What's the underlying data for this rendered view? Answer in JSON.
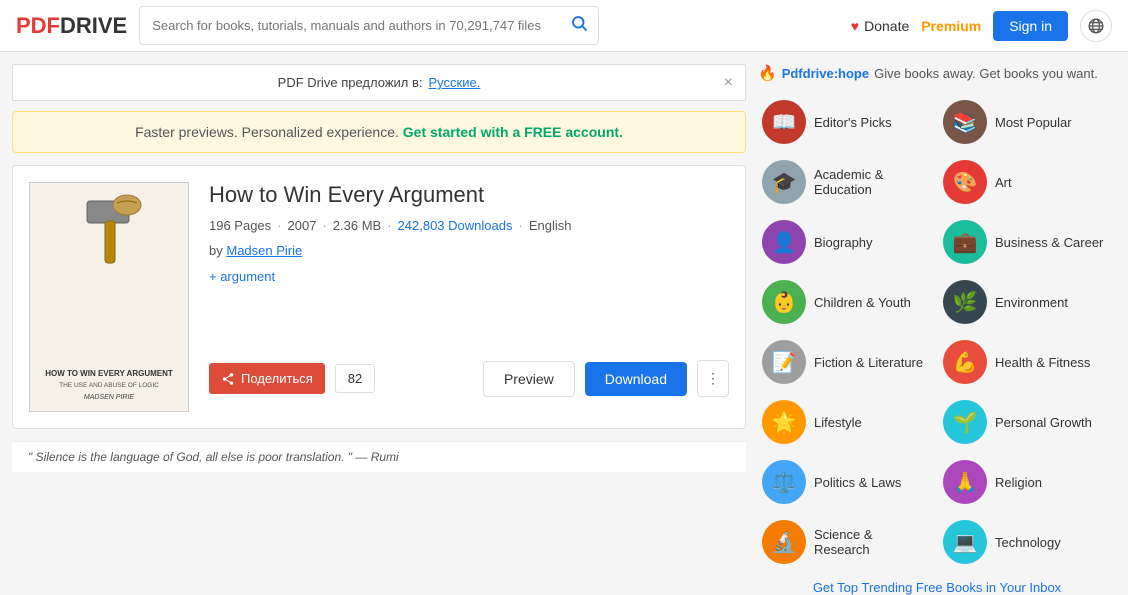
{
  "header": {
    "logo_pdf": "PDF",
    "logo_drive": "DRIVE",
    "search_placeholder": "Search for books, tutorials, manuals and authors in 70,291,747 files",
    "donate_label": "Donate",
    "premium_label": "Premium",
    "signin_label": "Sign in"
  },
  "lang_banner": {
    "text": "PDF Drive предложил в:",
    "link_text": "Русские.",
    "close_symbol": "×"
  },
  "promo_banner": {
    "text": "Faster previews. Personalized experience.",
    "cta": "Get started with a FREE account."
  },
  "book": {
    "title": "How to Win Every Argument",
    "pages": "196 Pages",
    "year": "2007",
    "size": "2.36 MB",
    "downloads": "242,803 Downloads",
    "language": "English",
    "author_prefix": "by",
    "author": "Madsen Pirie",
    "tag": "+ argument",
    "share_label": "Поделиться",
    "share_count": "82",
    "preview_label": "Preview",
    "download_label": "Download",
    "cover_title": "HOW TO WIN EVERY ARGUMENT",
    "cover_subtitle": "THE USE AND ABUSE OF LOGIC",
    "cover_author": "MADSEN PIRIE"
  },
  "quote": {
    "text": "\" Silence is the language of God, all else is poor translation. \" — Rumi"
  },
  "sidebar": {
    "hope_link": "Pdfdrive:hope",
    "hope_text": "Give books away. Get books you want.",
    "trending_link": "Get Top Trending Free Books in Your Inbox",
    "categories": [
      {
        "id": "editors-picks",
        "label": "Editor's Picks",
        "color": "#c0392b",
        "emoji": "📖"
      },
      {
        "id": "most-popular",
        "label": "Most Popular",
        "color": "#795548",
        "emoji": "📚"
      },
      {
        "id": "academic",
        "label": "Academic & Education",
        "color": "#90a4ae",
        "emoji": "🎓"
      },
      {
        "id": "art",
        "label": "Art",
        "color": "#e53935",
        "emoji": "🎨"
      },
      {
        "id": "biography",
        "label": "Biography",
        "color": "#8e44ad",
        "emoji": "👤"
      },
      {
        "id": "business",
        "label": "Business & Career",
        "color": "#1abc9c",
        "emoji": "💼"
      },
      {
        "id": "children",
        "label": "Children & Youth",
        "color": "#4caf50",
        "emoji": "👶"
      },
      {
        "id": "environment",
        "label": "Environment",
        "color": "#37474f",
        "emoji": "🌿"
      },
      {
        "id": "fiction",
        "label": "Fiction & Literature",
        "color": "#9e9e9e",
        "emoji": "📝"
      },
      {
        "id": "health",
        "label": "Health & Fitness",
        "color": "#e74c3c",
        "emoji": "💪"
      },
      {
        "id": "lifestyle",
        "label": "Lifestyle",
        "color": "#ff9800",
        "emoji": "🌟"
      },
      {
        "id": "personal",
        "label": "Personal Growth",
        "color": "#26c6da",
        "emoji": "🌱"
      },
      {
        "id": "politics",
        "label": "Politics & Laws",
        "color": "#42a5f5",
        "emoji": "⚖️"
      },
      {
        "id": "religion",
        "label": "Religion",
        "color": "#ab47bc",
        "emoji": "🙏"
      },
      {
        "id": "science",
        "label": "Science & Research",
        "color": "#f57c00",
        "emoji": "🔬"
      },
      {
        "id": "technology",
        "label": "Technology",
        "color": "#26c6da",
        "emoji": "💻"
      }
    ]
  }
}
